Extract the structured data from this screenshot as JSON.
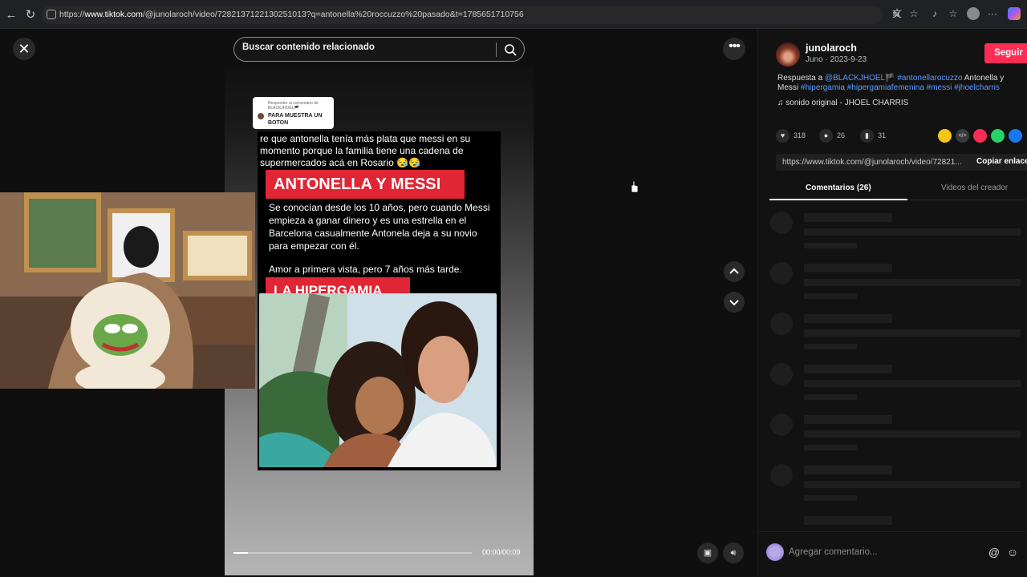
{
  "browser": {
    "url_prefix": "https://",
    "url_host": "www.tiktok.com",
    "url_rest": "/@junolaroch/video/7282137122130251013?q=antonella%20roccuzzo%20pasado&t=1785651710756",
    "icons": [
      "back-icon",
      "reload-icon",
      "translate-icon",
      "star-icon",
      "extensions-icon",
      "favorites-icon",
      "profile-icon",
      "more-icon",
      "copilot-icon"
    ]
  },
  "search": {
    "placeholder": "Buscar contenido relacionado"
  },
  "video": {
    "reply_small": "Responder al comentario de BLACKJHOEL🏴",
    "reply_big": "PARA MUESTRA UN BOTON",
    "top_text": "re que antonella tenía más plata que messi en su momento porque la familia tiene una cadena de supermercados acá en Rosario 😪😪",
    "banner1": "ANTONELLA Y MESSI",
    "body1": "Se conocían desde los 10 años, pero cuando Messi empieza a ganar dinero y es una estrella en el Barcelona casualmente Antonela deja a su novio para empezar con él.",
    "body2": "Amor a primera vista, pero 7 años más tarde.",
    "banner2": "LA HIPERGAMIA",
    "time": "00:00/00:09",
    "progress": 0.06
  },
  "author": {
    "username": "junolaroch",
    "subline": "Juno · 2023-9-23",
    "follow_label": "Seguir"
  },
  "description": {
    "prefix": "Respuesta a ",
    "mention": "@BLACKJHOEL🏴",
    "tags1": " #antonellarocuzzo",
    "plain": " Antonella y Messi ",
    "tags2": "#hipergamia #hipergamiafemenina #messi #jhoelcharris"
  },
  "sound": {
    "label": "sonido original - JHOEL CHARRIS"
  },
  "stats": {
    "likes": "318",
    "comments": "26",
    "saves": "31"
  },
  "share_colors": [
    "#f5c518",
    "#3a3a3a",
    "#fe2c55",
    "#25d366",
    "#1877f2"
  ],
  "link": {
    "url": "https://www.tiktok.com/@junolaroch/video/72821...",
    "copy_label": "Copiar enlace"
  },
  "tabs": {
    "comments": "Comentarios (26)",
    "creator": "Videos del creador"
  },
  "comment_box": {
    "placeholder": "Agregar comentario..."
  }
}
